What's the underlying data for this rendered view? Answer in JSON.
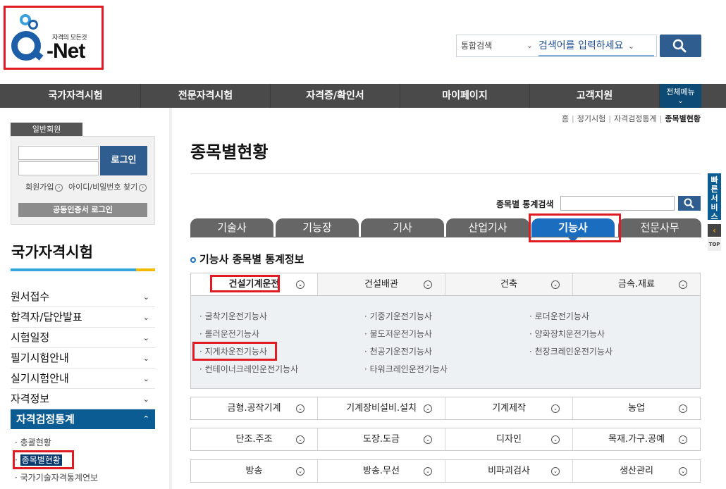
{
  "header": {
    "logo_slogan": "자격의 모든것",
    "logo_text": "Q-Net",
    "search_scope": "통합검색",
    "search_placeholder": "검색어를 입력하세요"
  },
  "gnb": {
    "items": [
      "국가자격시험",
      "전문자격시험",
      "자격증/확인서",
      "마이페이지",
      "고객지원"
    ],
    "all_menu": "전체메뉴"
  },
  "breadcrumb": [
    "홈",
    "정기시험",
    "자격검정통계",
    "종목별현황"
  ],
  "login": {
    "tag": "일반회원",
    "button": "로그인",
    "join": "회원가입",
    "find": "아이디/비밀번호 찾기",
    "cert": "공동인증서 로그인"
  },
  "sidebar": {
    "title": "국가자격시험",
    "items": [
      "원서접수",
      "합격자/답안발표",
      "시험일정",
      "필기시험안내",
      "실기시험안내",
      "자격정보"
    ],
    "active": "자격검정통계",
    "sub_items": [
      "총괄현황",
      "종목별현황",
      "국가기술자격통계연보"
    ]
  },
  "main": {
    "title": "종목별현황",
    "stat_search_label": "종목별 통계검색",
    "grade_tabs": [
      "기술사",
      "기능장",
      "기사",
      "산업기사",
      "기능사",
      "전문사무"
    ],
    "active_tab": "기능사",
    "section_heading": "기능사 종목별 통계정보",
    "category_rows": [
      [
        "건설기계운전",
        "건설배관",
        "건축",
        "금속.재료"
      ],
      [
        "금형.공작기계",
        "기계장비설비.설치",
        "기계제작",
        "농업"
      ],
      [
        "단조.주조",
        "도장.도금",
        "디자인",
        "목재.가구.공예"
      ],
      [
        "방송",
        "방송.무선",
        "비파괴검사",
        "생산관리"
      ]
    ],
    "qualifications": [
      [
        "굴착기운전기능사",
        "기중기운전기능사",
        "로더운전기능사"
      ],
      [
        "롤러운전기능사",
        "불도저운전기능사",
        "양화장치운전기능사"
      ],
      [
        "지게차운전기능사",
        "천공기운전기능사",
        "천장크레인운전기능사"
      ],
      [
        "컨테이너크레인운전기능사",
        "타워크레인운전기능사"
      ]
    ]
  },
  "quick": {
    "label": "빠른서비스",
    "top": "TOP"
  },
  "colors": {
    "accent_blue": "#1a6dbf",
    "nav_dark": "#4a4a4a",
    "highlight_red": "#e01b24",
    "side_active": "#0b5c93"
  }
}
